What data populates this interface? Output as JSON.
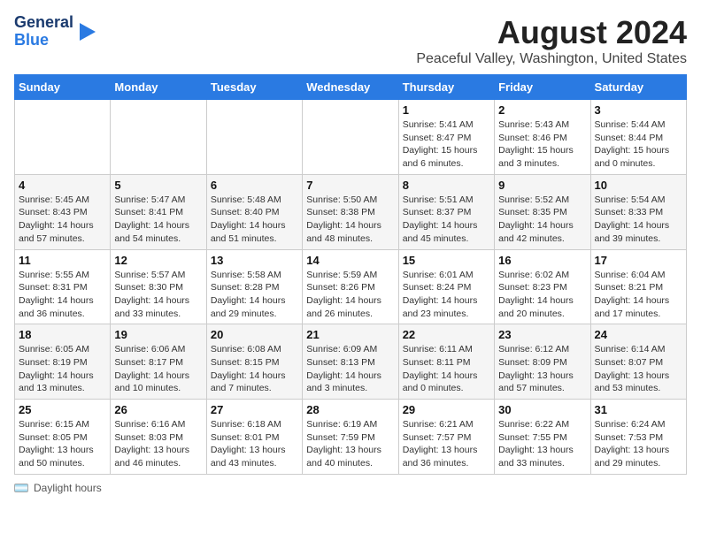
{
  "header": {
    "logo_line1": "General",
    "logo_line2": "Blue",
    "month_title": "August 2024",
    "location": "Peaceful Valley, Washington, United States"
  },
  "days_of_week": [
    "Sunday",
    "Monday",
    "Tuesday",
    "Wednesday",
    "Thursday",
    "Friday",
    "Saturday"
  ],
  "weeks": [
    [
      {
        "day": "",
        "info": ""
      },
      {
        "day": "",
        "info": ""
      },
      {
        "day": "",
        "info": ""
      },
      {
        "day": "",
        "info": ""
      },
      {
        "day": "1",
        "info": "Sunrise: 5:41 AM\nSunset: 8:47 PM\nDaylight: 15 hours\nand 6 minutes."
      },
      {
        "day": "2",
        "info": "Sunrise: 5:43 AM\nSunset: 8:46 PM\nDaylight: 15 hours\nand 3 minutes."
      },
      {
        "day": "3",
        "info": "Sunrise: 5:44 AM\nSunset: 8:44 PM\nDaylight: 15 hours\nand 0 minutes."
      }
    ],
    [
      {
        "day": "4",
        "info": "Sunrise: 5:45 AM\nSunset: 8:43 PM\nDaylight: 14 hours\nand 57 minutes."
      },
      {
        "day": "5",
        "info": "Sunrise: 5:47 AM\nSunset: 8:41 PM\nDaylight: 14 hours\nand 54 minutes."
      },
      {
        "day": "6",
        "info": "Sunrise: 5:48 AM\nSunset: 8:40 PM\nDaylight: 14 hours\nand 51 minutes."
      },
      {
        "day": "7",
        "info": "Sunrise: 5:50 AM\nSunset: 8:38 PM\nDaylight: 14 hours\nand 48 minutes."
      },
      {
        "day": "8",
        "info": "Sunrise: 5:51 AM\nSunset: 8:37 PM\nDaylight: 14 hours\nand 45 minutes."
      },
      {
        "day": "9",
        "info": "Sunrise: 5:52 AM\nSunset: 8:35 PM\nDaylight: 14 hours\nand 42 minutes."
      },
      {
        "day": "10",
        "info": "Sunrise: 5:54 AM\nSunset: 8:33 PM\nDaylight: 14 hours\nand 39 minutes."
      }
    ],
    [
      {
        "day": "11",
        "info": "Sunrise: 5:55 AM\nSunset: 8:31 PM\nDaylight: 14 hours\nand 36 minutes."
      },
      {
        "day": "12",
        "info": "Sunrise: 5:57 AM\nSunset: 8:30 PM\nDaylight: 14 hours\nand 33 minutes."
      },
      {
        "day": "13",
        "info": "Sunrise: 5:58 AM\nSunset: 8:28 PM\nDaylight: 14 hours\nand 29 minutes."
      },
      {
        "day": "14",
        "info": "Sunrise: 5:59 AM\nSunset: 8:26 PM\nDaylight: 14 hours\nand 26 minutes."
      },
      {
        "day": "15",
        "info": "Sunrise: 6:01 AM\nSunset: 8:24 PM\nDaylight: 14 hours\nand 23 minutes."
      },
      {
        "day": "16",
        "info": "Sunrise: 6:02 AM\nSunset: 8:23 PM\nDaylight: 14 hours\nand 20 minutes."
      },
      {
        "day": "17",
        "info": "Sunrise: 6:04 AM\nSunset: 8:21 PM\nDaylight: 14 hours\nand 17 minutes."
      }
    ],
    [
      {
        "day": "18",
        "info": "Sunrise: 6:05 AM\nSunset: 8:19 PM\nDaylight: 14 hours\nand 13 minutes."
      },
      {
        "day": "19",
        "info": "Sunrise: 6:06 AM\nSunset: 8:17 PM\nDaylight: 14 hours\nand 10 minutes."
      },
      {
        "day": "20",
        "info": "Sunrise: 6:08 AM\nSunset: 8:15 PM\nDaylight: 14 hours\nand 7 minutes."
      },
      {
        "day": "21",
        "info": "Sunrise: 6:09 AM\nSunset: 8:13 PM\nDaylight: 14 hours\nand 3 minutes."
      },
      {
        "day": "22",
        "info": "Sunrise: 6:11 AM\nSunset: 8:11 PM\nDaylight: 14 hours\nand 0 minutes."
      },
      {
        "day": "23",
        "info": "Sunrise: 6:12 AM\nSunset: 8:09 PM\nDaylight: 13 hours\nand 57 minutes."
      },
      {
        "day": "24",
        "info": "Sunrise: 6:14 AM\nSunset: 8:07 PM\nDaylight: 13 hours\nand 53 minutes."
      }
    ],
    [
      {
        "day": "25",
        "info": "Sunrise: 6:15 AM\nSunset: 8:05 PM\nDaylight: 13 hours\nand 50 minutes."
      },
      {
        "day": "26",
        "info": "Sunrise: 6:16 AM\nSunset: 8:03 PM\nDaylight: 13 hours\nand 46 minutes."
      },
      {
        "day": "27",
        "info": "Sunrise: 6:18 AM\nSunset: 8:01 PM\nDaylight: 13 hours\nand 43 minutes."
      },
      {
        "day": "28",
        "info": "Sunrise: 6:19 AM\nSunset: 7:59 PM\nDaylight: 13 hours\nand 40 minutes."
      },
      {
        "day": "29",
        "info": "Sunrise: 6:21 AM\nSunset: 7:57 PM\nDaylight: 13 hours\nand 36 minutes."
      },
      {
        "day": "30",
        "info": "Sunrise: 6:22 AM\nSunset: 7:55 PM\nDaylight: 13 hours\nand 33 minutes."
      },
      {
        "day": "31",
        "info": "Sunrise: 6:24 AM\nSunset: 7:53 PM\nDaylight: 13 hours\nand 29 minutes."
      }
    ]
  ],
  "footer": {
    "label": "Daylight hours"
  }
}
